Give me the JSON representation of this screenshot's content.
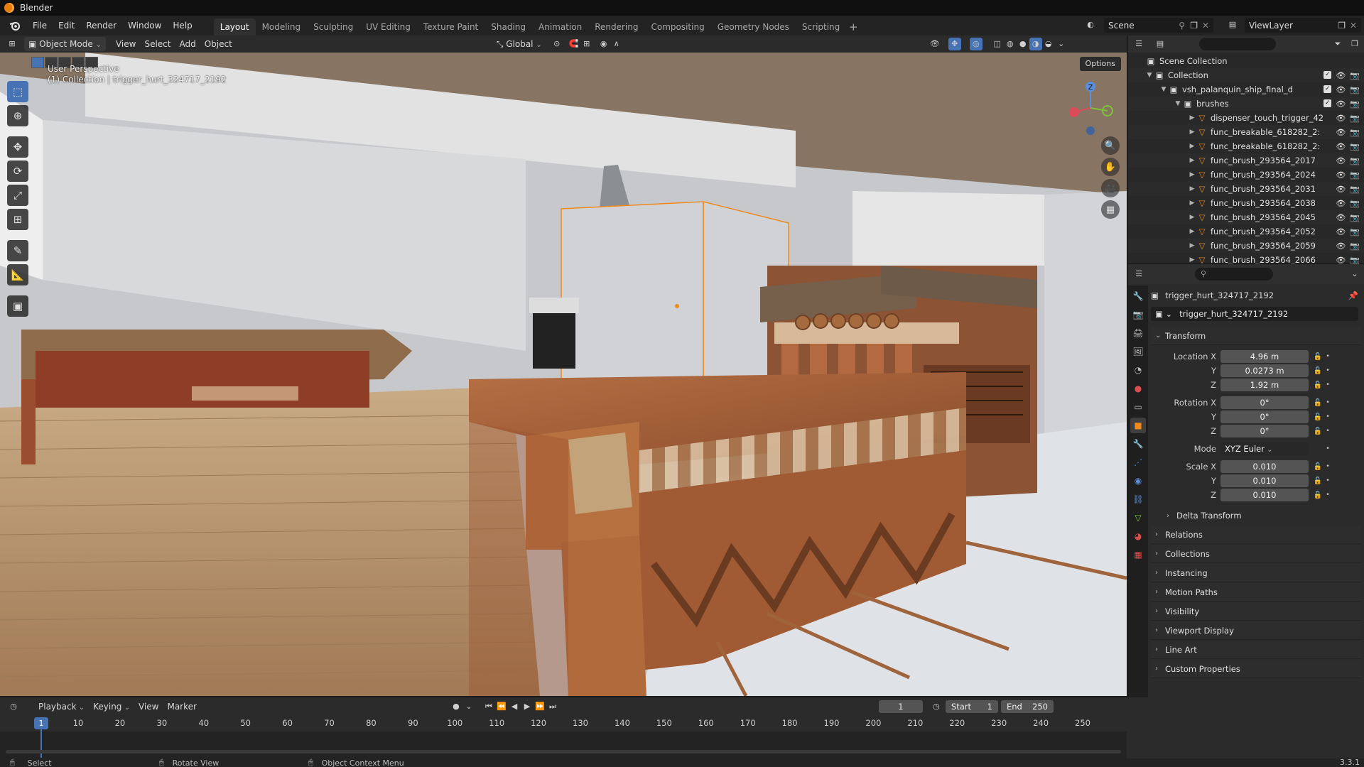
{
  "window": {
    "title": "Blender"
  },
  "menu": [
    "File",
    "Edit",
    "Render",
    "Window",
    "Help"
  ],
  "workspaces": [
    "Layout",
    "Modeling",
    "Sculpting",
    "UV Editing",
    "Texture Paint",
    "Shading",
    "Animation",
    "Rendering",
    "Compositing",
    "Geometry Nodes",
    "Scripting"
  ],
  "active_workspace": "Layout",
  "scene": "Scene",
  "view_layer": "ViewLayer",
  "viewport_header": {
    "mode": "Object Mode",
    "menus": [
      "View",
      "Select",
      "Add",
      "Object"
    ],
    "orientation": "Global",
    "options": "Options"
  },
  "viewport": {
    "perspective_label": "User Perspective",
    "collection_label": "(1) Collection | trigger_hurt_324717_2192",
    "gizmo_axis_label": "Z"
  },
  "outliner": {
    "search_placeholder": "",
    "scene_collection": "Scene Collection",
    "collection": "Collection",
    "ship": "vsh_palanquin_ship_final_d",
    "brushes": "brushes",
    "items": [
      "dispenser_touch_trigger_42",
      "func_breakable_618282_2:",
      "func_breakable_618282_2:",
      "func_brush_293564_2017",
      "func_brush_293564_2024",
      "func_brush_293564_2031",
      "func_brush_293564_2038",
      "func_brush_293564_2045",
      "func_brush_293564_2052",
      "func_brush_293564_2059",
      "func_brush_293564_2066"
    ]
  },
  "properties": {
    "object_title": "trigger_hurt_324717_2192",
    "object_name": "trigger_hurt_324717_2192",
    "transform_label": "Transform",
    "location_label": "Location X",
    "rotation_label": "Rotation X",
    "scale_label": "Scale X",
    "y_label": "Y",
    "z_label": "Z",
    "mode_label": "Mode",
    "location": {
      "x": "4.96 m",
      "y": "0.0273 m",
      "z": "1.92 m"
    },
    "rotation": {
      "x": "0°",
      "y": "0°",
      "z": "0°"
    },
    "rotation_mode": "XYZ Euler",
    "scale": {
      "x": "0.010",
      "y": "0.010",
      "z": "0.010"
    },
    "delta_transform": "Delta Transform",
    "sections": [
      "Relations",
      "Collections",
      "Instancing",
      "Motion Paths",
      "Visibility",
      "Viewport Display",
      "Line Art",
      "Custom Properties"
    ]
  },
  "timeline": {
    "menus": [
      "Playback",
      "Keying",
      "View",
      "Marker"
    ],
    "current_frame": "1",
    "start_label": "Start",
    "start": "1",
    "end_label": "End",
    "end": "250",
    "ticks": [
      "10",
      "20",
      "30",
      "40",
      "50",
      "60",
      "70",
      "80",
      "90",
      "100",
      "110",
      "120",
      "130",
      "140",
      "150",
      "160",
      "170",
      "180",
      "190",
      "200",
      "210",
      "220",
      "230",
      "240",
      "250"
    ],
    "playhead": "1"
  },
  "statusbar": {
    "select": "Select",
    "rotate": "Rotate View",
    "context": "Object Context Menu",
    "version": "3.3.1"
  }
}
